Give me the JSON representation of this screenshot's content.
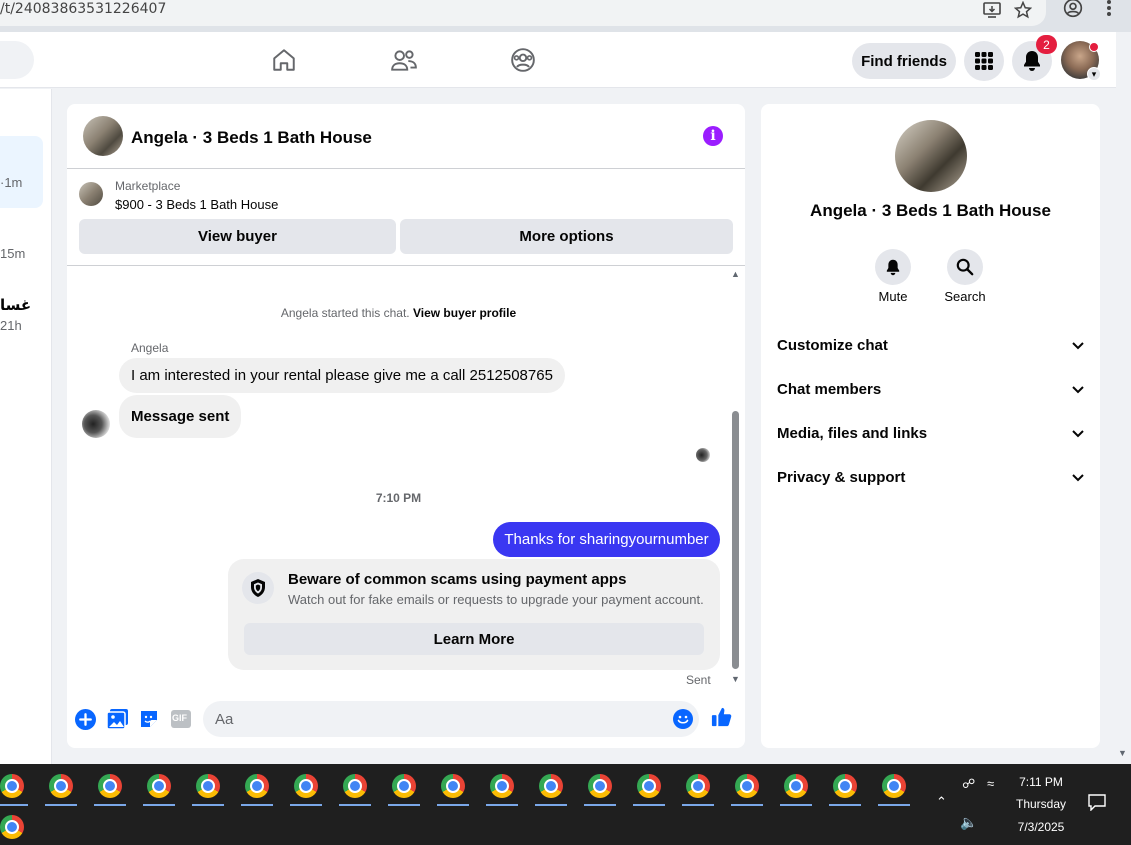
{
  "browser": {
    "url": "/t/24083863531226407"
  },
  "fb_nav": {
    "find_friends": "Find friends",
    "notification_count": "2"
  },
  "left_sidebar": {
    "times": [
      "·1m",
      "15m",
      "21h"
    ],
    "snippet": "غسا"
  },
  "chat": {
    "title": "Angela · 3 Beds 1 Bath House",
    "marketplace_label": "Marketplace",
    "listing": "$900 - 3 Beds 1 Bath House",
    "view_buyer": "View buyer",
    "more_options": "More options",
    "system_prefix": "Angela started this chat.",
    "view_buyer_profile": "View buyer profile",
    "sender_name": "Angela",
    "incoming": [
      "I am interested in your rental  please give me a call 2512508765",
      "Message sent"
    ],
    "timestamp": "7:10 PM",
    "outgoing": "Thanks for sharingyournumber",
    "scam_title": "Beware of common scams using payment apps",
    "scam_body": "Watch out for fake emails or requests to upgrade your payment account.",
    "learn_more": "Learn More",
    "sent_status": "Sent",
    "input_placeholder": "Aa",
    "gif": "GIF"
  },
  "right_panel": {
    "title": "Angela · 3 Beds 1 Bath House",
    "actions": [
      "Mute",
      "Search"
    ],
    "sections": [
      "Customize chat",
      "Chat members",
      "Media, files and links",
      "Privacy & support"
    ]
  },
  "taskbar": {
    "time": "7:11 PM",
    "day": "Thursday",
    "date": "7/3/2025"
  },
  "colors": {
    "accent": "#0866ff",
    "outgoing_bubble": "#3a37f2",
    "info": "#9b1dff",
    "badge": "#e41e3f"
  }
}
